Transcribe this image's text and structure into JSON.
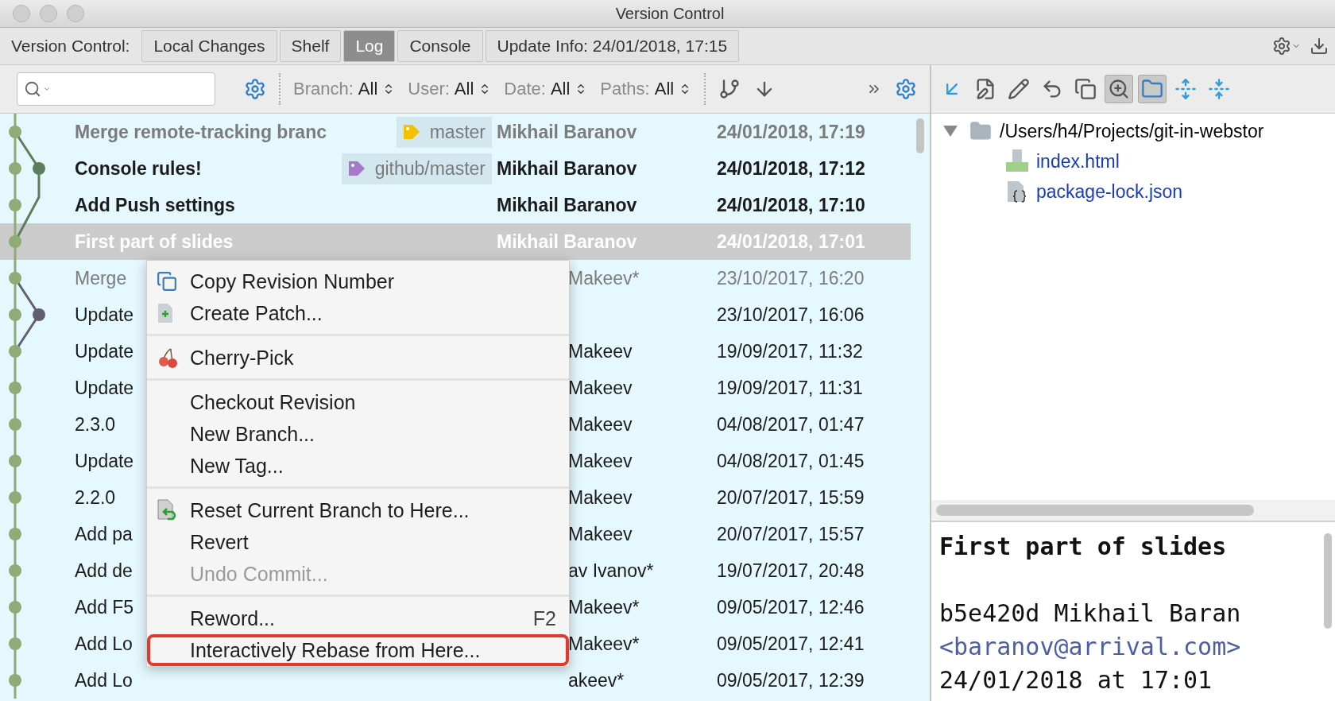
{
  "window": {
    "title": "Version Control"
  },
  "tab_bar": {
    "label": "Version Control:",
    "tabs": [
      {
        "label": "Local Changes",
        "selected": false
      },
      {
        "label": "Shelf",
        "selected": false
      },
      {
        "label": "Log",
        "selected": true
      },
      {
        "label": "Console",
        "selected": false
      },
      {
        "label": "Update Info: 24/01/2018, 17:15",
        "selected": false
      }
    ]
  },
  "toolbar": {
    "filters": [
      {
        "label": "Branch:",
        "value": "All"
      },
      {
        "label": "User:",
        "value": "All"
      },
      {
        "label": "Date:",
        "value": "All"
      },
      {
        "label": "Paths:",
        "value": "All"
      }
    ]
  },
  "log": {
    "rows": [
      {
        "subject": "Merge remote-tracking branc",
        "tag": {
          "label": "master",
          "color": "#f2c200"
        },
        "author": "Mikhail Baranov",
        "date": "24/01/2018, 17:19",
        "unpushed": true,
        "merge": true,
        "selected": false
      },
      {
        "subject": "Console rules!",
        "tag": {
          "label": "github/master",
          "color": "#a77ac9"
        },
        "author": "Mikhail Baranov",
        "date": "24/01/2018, 17:12",
        "unpushed": true,
        "merge": false,
        "selected": false
      },
      {
        "subject": "Add Push settings",
        "author": "Mikhail Baranov",
        "date": "24/01/2018, 17:10",
        "unpushed": true,
        "merge": false,
        "selected": false
      },
      {
        "subject": "First part of slides",
        "author": "Mikhail Baranov",
        "date": "24/01/2018, 17:01",
        "unpushed": true,
        "merge": false,
        "selected": true
      },
      {
        "subject": "Merge",
        "author": "Makeev*",
        "date": "23/10/2017, 16:20",
        "unpushed": false,
        "merge": true,
        "selected": false
      },
      {
        "subject": "Update",
        "date": "23/10/2017, 16:06",
        "unpushed": false,
        "merge": false,
        "selected": false
      },
      {
        "subject": "Update",
        "author": "Makeev",
        "date": "19/09/2017, 11:32",
        "unpushed": false,
        "merge": false,
        "selected": false
      },
      {
        "subject": "Update",
        "author": "Makeev",
        "date": "19/09/2017, 11:31",
        "unpushed": false,
        "merge": false,
        "selected": false
      },
      {
        "subject": "2.3.0",
        "author": "Makeev",
        "date": "04/08/2017, 01:47",
        "unpushed": false,
        "merge": false,
        "selected": false
      },
      {
        "subject": "Update",
        "author": "Makeev",
        "date": "04/08/2017, 01:45",
        "unpushed": false,
        "merge": false,
        "selected": false
      },
      {
        "subject": "2.2.0",
        "author": "Makeev",
        "date": "20/07/2017, 15:59",
        "unpushed": false,
        "merge": false,
        "selected": false
      },
      {
        "subject": "Add pa",
        "author": "Makeev",
        "date": "20/07/2017, 15:57",
        "unpushed": false,
        "merge": false,
        "selected": false
      },
      {
        "subject": "Add de",
        "author": "av Ivanov*",
        "date": "19/07/2017, 20:48",
        "unpushed": false,
        "merge": false,
        "selected": false
      },
      {
        "subject": "Add F5",
        "author": "Makeev*",
        "date": "09/05/2017, 12:46",
        "unpushed": false,
        "merge": false,
        "selected": false
      },
      {
        "subject": "Add Lo",
        "author": "Makeev*",
        "date": "09/05/2017, 12:41",
        "unpushed": false,
        "merge": false,
        "selected": false
      },
      {
        "subject": "Add Lo",
        "author": "akeev*",
        "date": "09/05/2017, 12:39",
        "unpushed": false,
        "merge": false,
        "selected": false
      }
    ]
  },
  "context_menu": {
    "groups": [
      [
        {
          "label": "Copy Revision Number",
          "disabled": false,
          "highlighted": false
        },
        {
          "label": "Create Patch...",
          "disabled": false,
          "highlighted": false
        }
      ],
      [
        {
          "label": "Cherry-Pick",
          "disabled": false,
          "highlighted": false
        }
      ],
      [
        {
          "label": "Checkout Revision",
          "disabled": false,
          "highlighted": false
        },
        {
          "label": "New Branch...",
          "disabled": false,
          "highlighted": false
        },
        {
          "label": "New Tag...",
          "disabled": false,
          "highlighted": false
        }
      ],
      [
        {
          "label": "Reset Current Branch to Here...",
          "disabled": false,
          "highlighted": false
        },
        {
          "label": "Revert",
          "disabled": false,
          "highlighted": false
        },
        {
          "label": "Undo Commit...",
          "disabled": true,
          "highlighted": false
        }
      ],
      [
        {
          "label": "Reword...",
          "shortcut": "F2",
          "disabled": false,
          "highlighted": false
        },
        {
          "label": "Interactively Rebase from Here...",
          "disabled": false,
          "highlighted": true
        }
      ]
    ]
  },
  "changes_toolbar": {
    "buttons": [
      {
        "on": false
      },
      {
        "on": false
      },
      {
        "on": false
      },
      {
        "on": false
      },
      {
        "on": false
      },
      {
        "on": true
      },
      {
        "on": true
      },
      {
        "on": false
      },
      {
        "on": false
      }
    ]
  },
  "changes_tree": {
    "root": {
      "label": "/Users/h4/Projects/git-in-webstor",
      "expanded": true,
      "children": [
        {
          "label": "index.html",
          "kind": "html"
        },
        {
          "label": "package-lock.json",
          "kind": "json"
        }
      ]
    }
  },
  "details": {
    "subject": "First part of slides",
    "hash_author": "b5e420d Mikhail Baran",
    "email": "<baranov@arrival.com>",
    "date": "24/01/2018 at 17:01"
  }
}
